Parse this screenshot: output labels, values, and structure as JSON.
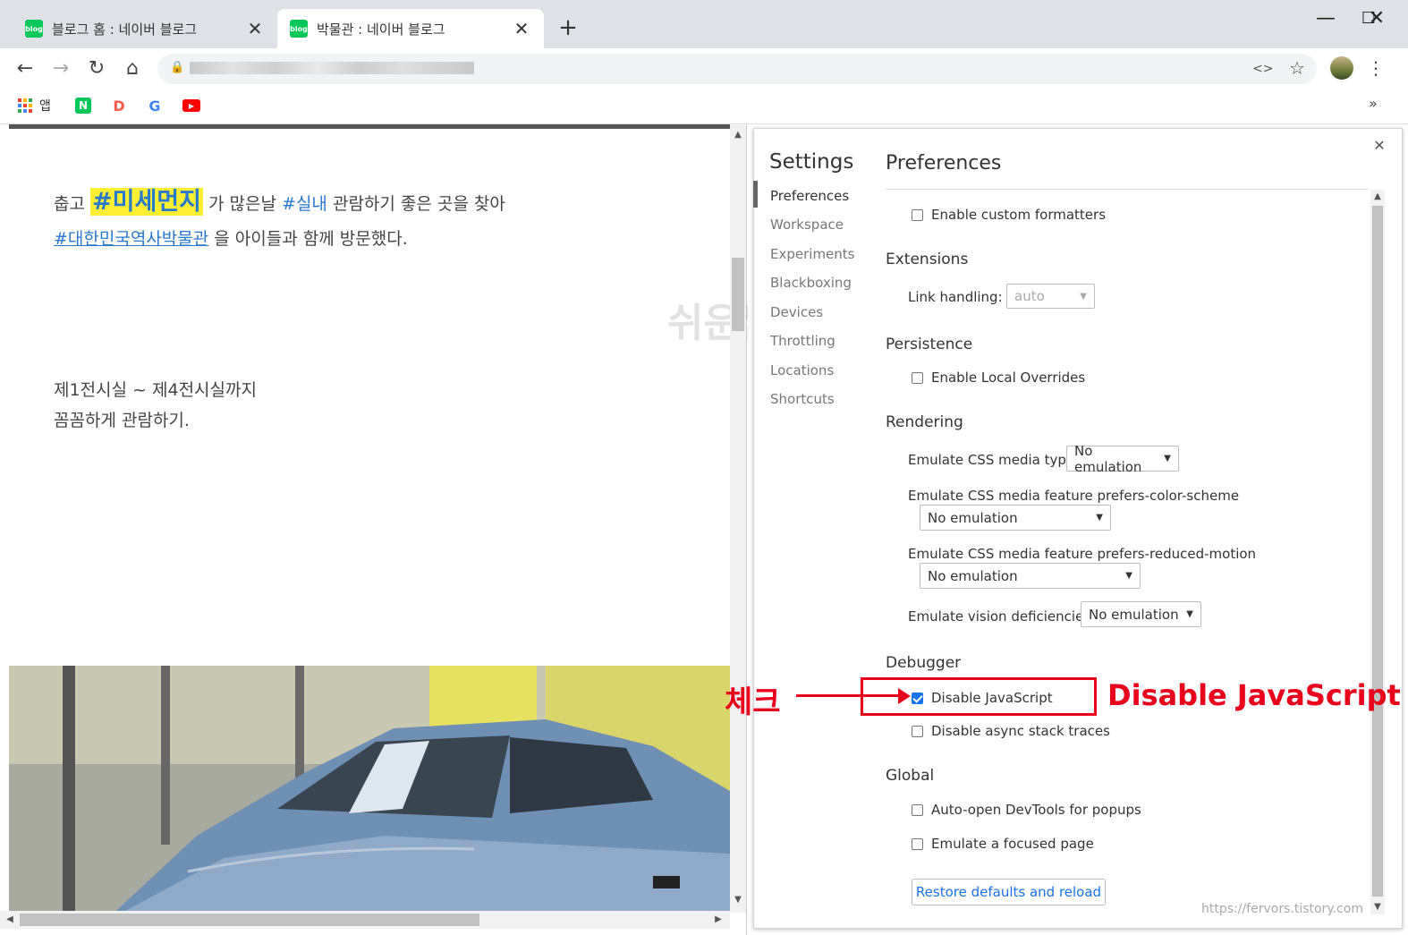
{
  "browser": {
    "tabs": [
      {
        "title": "블로그 홈 : 네이버 블로그",
        "active": false,
        "favicon": "blog"
      },
      {
        "title": "박물관 : 네이버 블로그",
        "active": true,
        "favicon": "blog"
      }
    ],
    "bookmarks": [
      {
        "label": "앱",
        "icon": "apps-grid-icon"
      },
      {
        "label": "",
        "icon": "naver-icon",
        "glyph": "N",
        "color": "#03c75a"
      },
      {
        "label": "",
        "icon": "daum-icon",
        "glyph": "D",
        "color": "#ff5a4a"
      },
      {
        "label": "",
        "icon": "google-icon",
        "glyph": "G",
        "color": "#4285f4"
      },
      {
        "label": "",
        "icon": "youtube-icon",
        "glyph": "▶",
        "color": "#ff0000"
      }
    ],
    "overflow_label": "»"
  },
  "page": {
    "para1_plain1": "춥고 ",
    "hashtag_highlight": "#미세먼지",
    "para1_plain2": " 가 많은날 ",
    "hashtag_indoor": "#실내",
    "para1_plain3": " 관람하기 좋은 곳을 찾아",
    "hashtag_museum": "#대한민국역사박물관",
    "para2_plain": " 을 아이들과 함께 방문했다.",
    "line3": "제1전시실 ~ 제4전시실까지",
    "line4": "꼼꼼하게 관람하기.",
    "watermark": "쉬운쌤"
  },
  "devtools": {
    "settings_title": "Settings",
    "nav": [
      "Preferences",
      "Workspace",
      "Experiments",
      "Blackboxing",
      "Devices",
      "Throttling",
      "Locations",
      "Shortcuts"
    ],
    "preferences_title": "Preferences",
    "enable_custom_formatters": "Enable custom formatters",
    "extensions": {
      "title": "Extensions",
      "link_label": "Link handling:",
      "link_value": "auto"
    },
    "persistence": {
      "title": "Persistence",
      "local_overrides": "Enable Local Overrides"
    },
    "rendering": {
      "title": "Rendering",
      "media_type_label": "Emulate CSS media type",
      "media_type_value": "No emulation",
      "color_scheme_label": "Emulate CSS media feature prefers-color-scheme",
      "color_scheme_value": "No emulation",
      "reduced_motion_label": "Emulate CSS media feature prefers-reduced-motion",
      "reduced_motion_value": "No emulation",
      "vision_label": "Emulate vision deficiencies",
      "vision_value": "No emulation"
    },
    "debugger": {
      "title": "Debugger",
      "disable_js": "Disable JavaScript",
      "disable_js_checked": true,
      "disable_async": "Disable async stack traces"
    },
    "global": {
      "title": "Global",
      "auto_open": "Auto-open DevTools for popups",
      "focused_page": "Emulate a focused page"
    },
    "restore_button": "Restore defaults and reload",
    "credit": "https://fervors.tistory.com"
  },
  "annotation": {
    "check_label": "체크",
    "callout": "Disable JavaScript",
    "color": "#e8001c"
  }
}
